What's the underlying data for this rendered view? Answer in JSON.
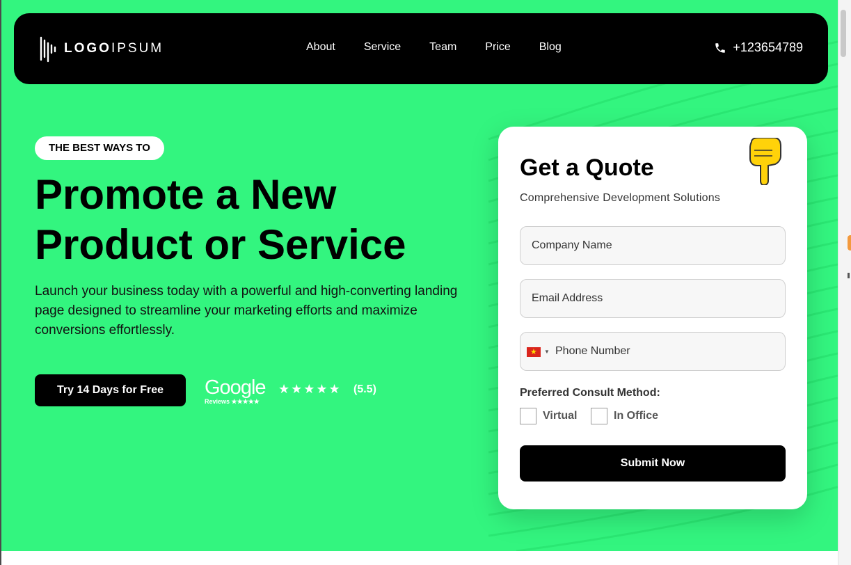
{
  "brand": {
    "logo_bold": "LOGO",
    "logo_light": "IPSUM"
  },
  "nav": {
    "items": [
      {
        "label": "About"
      },
      {
        "label": "Service"
      },
      {
        "label": "Team"
      },
      {
        "label": "Price"
      },
      {
        "label": "Blog"
      }
    ],
    "phone": "+123654789",
    "phone_icon": "phone-icon"
  },
  "hero": {
    "eyebrow": "THE BEST WAYS TO",
    "headline_line1": "Promote a New",
    "headline_line2": "Product or Service",
    "description": "Launch your business today with a powerful and high-converting landing page designed to streamline your marketing efforts and maximize conversions effortlessly.",
    "cta_label": "Try 14 Days for Free",
    "review_brand": "Google",
    "review_sub": "Reviews ★★★★★",
    "stars": "★★★★★",
    "rating": "(5.5)"
  },
  "quote": {
    "title": "Get a Quote",
    "subtitle": "Comprehensive Development Solutions",
    "company_placeholder": "Company Name",
    "email_placeholder": "Email Address",
    "phone_placeholder": "Phone Number",
    "method_label": "Preferred Consult Method:",
    "options": [
      {
        "label": "Virtual"
      },
      {
        "label": "In Office"
      }
    ],
    "submit_label": "Submit Now",
    "hand_icon": "pointing-down-hand-icon"
  },
  "colors": {
    "hero_bg": "#33f57f",
    "nav_bg": "#000000",
    "card_bg": "#ffffff",
    "button_bg": "#000000"
  }
}
